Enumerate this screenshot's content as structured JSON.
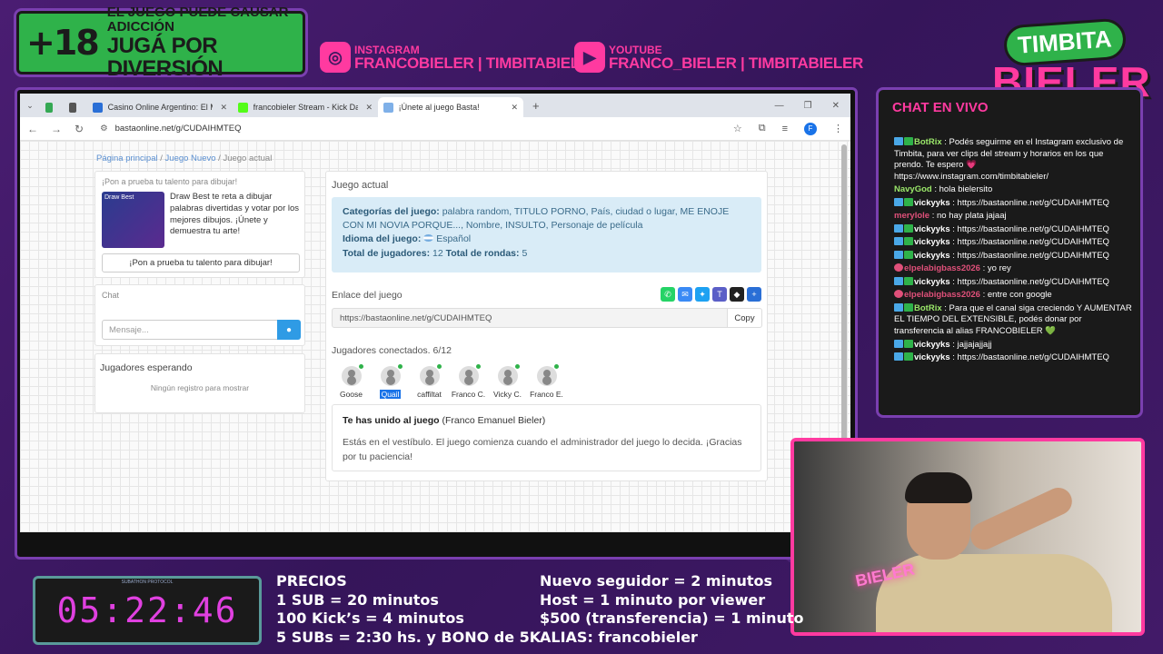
{
  "overlay": {
    "warning": {
      "age": "+18",
      "line1": "EL JUEGO PUEDE CAUSAR ADICCIÓN",
      "line2": "JUGÁ POR DIVERSIÓN"
    },
    "instagram": {
      "label": "INSTAGRAM",
      "handle": "FRANCOBIELER | TIMBITABIELER"
    },
    "youtube": {
      "label": "YOUTUBE",
      "handle": "FRANCO_BIELER | TIMBITABIELER"
    },
    "logo": {
      "top": "TIMBITA",
      "bottom": "BIELER"
    },
    "chat_title": "CHAT EN VIVO",
    "timer": {
      "caption": "SUBATHON PROTOCOL",
      "value": "05:22:46"
    },
    "prices": [
      "PRECIOS",
      "1 SUB = 20 minutos",
      "100 Kick’s = 4 minutos",
      "5 SUBs = 2:30 hs. y BONO de 5K"
    ],
    "rates": [
      "Nuevo seguidor = 2 minutos",
      "Host = 1 minuto por viewer",
      "$500 (transferencia) = 1 minuto",
      "ALIAS: francobieler"
    ],
    "cam_neon": "BIELER"
  },
  "chat": [
    {
      "badges": [
        "b",
        "g"
      ],
      "user": "BotRix",
      "color": "#9be86a",
      "text": "Podés seguirme en el Instagram exclusivo de Timbita, para ver clips del stream y horarios en los que prendo. Te espero 💗 https://www.instagram.com/timbitabieler/"
    },
    {
      "badges": [],
      "user": "NavyGod",
      "color": "#9be86a",
      "text": "hola bielersito"
    },
    {
      "badges": [
        "b",
        "g"
      ],
      "user": "vickyyks",
      "color": "#ffffff",
      "text": "https://bastaonline.net/g/CUDAIHMTEQ"
    },
    {
      "badges": [],
      "user": "merylole",
      "color": "#e0507a",
      "text": "no hay plata jajaaj"
    },
    {
      "badges": [
        "b",
        "g"
      ],
      "user": "vickyyks",
      "color": "#ffffff",
      "text": "https://bastaonline.net/g/CUDAIHMTEQ"
    },
    {
      "badges": [
        "b",
        "g"
      ],
      "user": "vickyyks",
      "color": "#ffffff",
      "text": "https://bastaonline.net/g/CUDAIHMTEQ"
    },
    {
      "badges": [
        "b",
        "g"
      ],
      "user": "vickyyks",
      "color": "#ffffff",
      "text": "https://bastaonline.net/g/CUDAIHMTEQ"
    },
    {
      "badges": [
        "p"
      ],
      "user": "elpelabigbass2026",
      "color": "#e0507a",
      "text": "yo rey"
    },
    {
      "badges": [
        "b",
        "g"
      ],
      "user": "vickyyks",
      "color": "#ffffff",
      "text": "https://bastaonline.net/g/CUDAIHMTEQ"
    },
    {
      "badges": [
        "p"
      ],
      "user": "elpelabigbass2026",
      "color": "#e0507a",
      "text": "entre con google"
    },
    {
      "badges": [
        "b",
        "g"
      ],
      "user": "BotRix",
      "color": "#9be86a",
      "text": "Para que el canal siga creciendo Y AUMENTAR EL TIEMPO DEL EXTENSIBLE, podés donar por transferencia al alias FRANCOBIELER 💚"
    },
    {
      "badges": [
        "b",
        "g"
      ],
      "user": "vickyyks",
      "color": "#ffffff",
      "text": "jajjajajjajj"
    },
    {
      "badges": [
        "b",
        "g"
      ],
      "user": "vickyyks",
      "color": "#ffffff",
      "text": "https://bastaonline.net/g/CUDAIHMTEQ"
    }
  ],
  "browser": {
    "tabs": [
      {
        "title": "",
        "fav": "#34a853"
      },
      {
        "title": "",
        "fav": "#555"
      },
      {
        "title": "Casino Online Argentino: El Me",
        "fav": "#2a6fd6"
      },
      {
        "title": "francobieler Stream - Kick Dash",
        "fav": "#53fc18"
      },
      {
        "title": "¡Únete al juego Basta!",
        "fav": "#7fb0e8",
        "active": true
      }
    ],
    "url": "bastaonline.net/g/CUDAIHMTEQ",
    "profile_initial": "F"
  },
  "page": {
    "breadcrumb": {
      "home": "Página principal",
      "new": "Juego Nuevo",
      "current": "Juego actual"
    },
    "promo": {
      "header": "¡Pon a prueba tu talento para dibujar!",
      "img_label": "Draw Best",
      "text": "Draw Best te reta a dibujar palabras divertidas y votar por los mejores dibujos. ¡Únete y demuestra tu arte!",
      "button": "¡Pon a prueba tu talento para dibujar!"
    },
    "chat": {
      "header": "Chat",
      "placeholder": "Mensaje..."
    },
    "waiting": {
      "header": "Jugadores esperando",
      "empty": "Ningún registro para mostrar"
    },
    "game": {
      "header": "Juego actual",
      "categories_label": "Categorías del juego:",
      "categories": "palabra random, TITULO PORNO, País, ciudad o lugar, ME ENOJE CON MI NOVIA PORQUE..., Nombre, INSULTO, Personaje de película",
      "language_label": "Idioma del juego:",
      "language": "Español",
      "players_label": "Total de jugadores:",
      "players": "12",
      "rounds_label": "Total de rondas:",
      "rounds": "5",
      "link_label": "Enlace del juego",
      "link": "https://bastaonline.net/g/CUDAIHMTEQ",
      "copy": "Copy",
      "connected": "Jugadores conectados. 6/12",
      "players_list": [
        "Goose",
        "Quail",
        "caffiltat",
        "Franco C.",
        "Vicky C.",
        "Franco E."
      ],
      "joined_title": "Te has unido al juego",
      "joined_name": "(Franco Emanuel Bieler)",
      "joined_text": "Estás en el vestíbulo. El juego comienza cuando el administrador del juego lo decida. ¡Gracias por tu paciencia!"
    }
  }
}
